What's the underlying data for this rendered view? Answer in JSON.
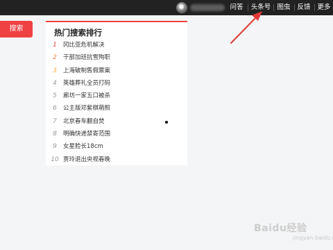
{
  "topbar": {
    "nav": [
      "问答",
      "头条号",
      "图虫",
      "反馈",
      "更多"
    ]
  },
  "search": {
    "label": "搜索"
  },
  "hot": {
    "title": "热门搜索排行",
    "items": [
      {
        "rank": "1",
        "text": "冈比亚危机解决"
      },
      {
        "rank": "2",
        "text": "干部加班抗雪殉职"
      },
      {
        "rank": "3",
        "text": "上海破制售假票案"
      },
      {
        "rank": "4",
        "text": "英雄葬礼全员打码"
      },
      {
        "rank": "5",
        "text": "廊坊一家五口被杀"
      },
      {
        "rank": "6",
        "text": "公主版邓紫棋萌照"
      },
      {
        "rank": "7",
        "text": "北京春车翻自焚"
      },
      {
        "rank": "8",
        "text": "明确快递禁寄范围"
      },
      {
        "rank": "9",
        "text": "女星脸长18cm"
      },
      {
        "rank": "10",
        "text": "贾玲退出央视春晚"
      }
    ]
  },
  "watermark": {
    "brand": "Baidu经验",
    "url": "jingyan.baidu.com"
  },
  "colors": {
    "accent": "#f04142",
    "topbar": "#222222"
  }
}
